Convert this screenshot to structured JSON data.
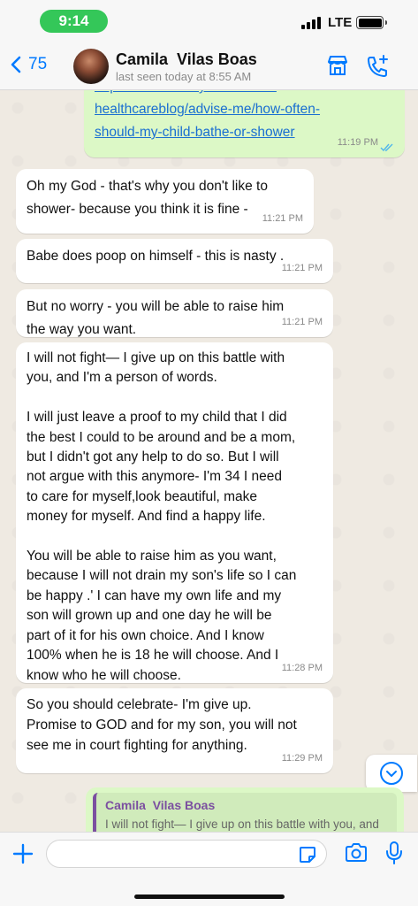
{
  "status": {
    "time": "9:14",
    "network": "LTE"
  },
  "header": {
    "back_count": "75",
    "contact_name": "Camila  Vilas Boas",
    "last_seen": "last seen today at 8:55 AM"
  },
  "messages": [
    {
      "direction": "out",
      "text": "https://www.bunnyhealth.com/\nhealthcareblog/advise-me/how-often-\nshould-my-child-bathe-or-shower",
      "time": "11:19 PM",
      "read": true
    },
    {
      "direction": "in",
      "text": "Oh my God - that's why you don't like to\nshower- because you think it is fine -",
      "time": "11:21 PM"
    },
    {
      "direction": "in",
      "text": "Babe does poop on himself - this is nasty .",
      "time": "11:21 PM"
    },
    {
      "direction": "in",
      "text": "But no worry - you will be able to raise him\nthe way you want.",
      "time": "11:21 PM"
    },
    {
      "direction": "in",
      "text": "I will not fight— I give up on this battle with\nyou, and I'm a person of words.\n\nI will just leave a proof to my child that I did\nthe best I could to be around and be a mom,\nbut I didn't got any help to do so. But I will\nnot argue with this anymore- I'm 34 I need\nto care for myself,look beautiful, make\nmoney for myself. And find a happy life.\n\nYou will be able to raise him as you want,\nbecause I will not drain my son's life so I can\nbe happy .' I can have my own life and my\nson will grown up and one day he will be\npart of it for his own choice. And I know\n100% when he is 18 he will choose. And I\nknow who he will choose.",
      "time": "11:28 PM"
    },
    {
      "direction": "in",
      "text": "So you should celebrate- I'm give up.\nPromise to GOD and for my son, you will not\nsee me in court fighting for anything.",
      "time": "11:29 PM"
    }
  ],
  "quoted_reply": {
    "author": "Camila  Vilas Boas",
    "text": "I will not fight— I give up on this battle with you, and"
  },
  "icons": {
    "back": "chevron-left-icon",
    "store": "storefront-icon",
    "call": "phone-add-icon",
    "plus": "plus-icon",
    "sticker": "sticker-icon",
    "camera": "camera-icon",
    "mic": "microphone-icon",
    "scroll": "chevron-down-icon"
  },
  "colors": {
    "accent": "#007aff",
    "outgoing_bubble": "#dcf8c6",
    "incoming_bubble": "#ffffff",
    "time_pill": "#34c759"
  }
}
